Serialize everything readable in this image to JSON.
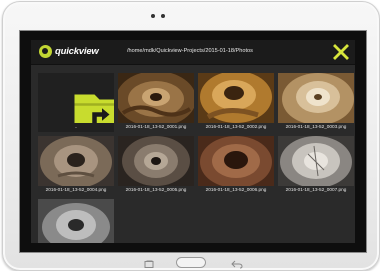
{
  "app": {
    "name": "quickview",
    "path": "/home/mdk/Quickview-Projects/2015-01-18/Photos",
    "accent_color": "#c2d633"
  },
  "toolbar": {
    "close_icon": "close-x-icon"
  },
  "folder": {
    "icon": "folder-up-icon",
    "label": ".."
  },
  "photos": [
    {
      "name": "2016-01-18_13-52_0001.png"
    },
    {
      "name": "2016-01-18_13-52_0002.png"
    },
    {
      "name": "2016-01-18_13-52_0003.png"
    },
    {
      "name": "2016-01-18_13-52_0004.png"
    },
    {
      "name": "2016-01-18_13-52_0005.png"
    },
    {
      "name": "2016-01-18_13-52_0006.png"
    },
    {
      "name": "2016-01-18_13-52_0007.png"
    },
    {
      "name": ""
    }
  ],
  "device_nav": {
    "icons": [
      "recent-apps-icon",
      "home-icon",
      "back-icon"
    ]
  }
}
